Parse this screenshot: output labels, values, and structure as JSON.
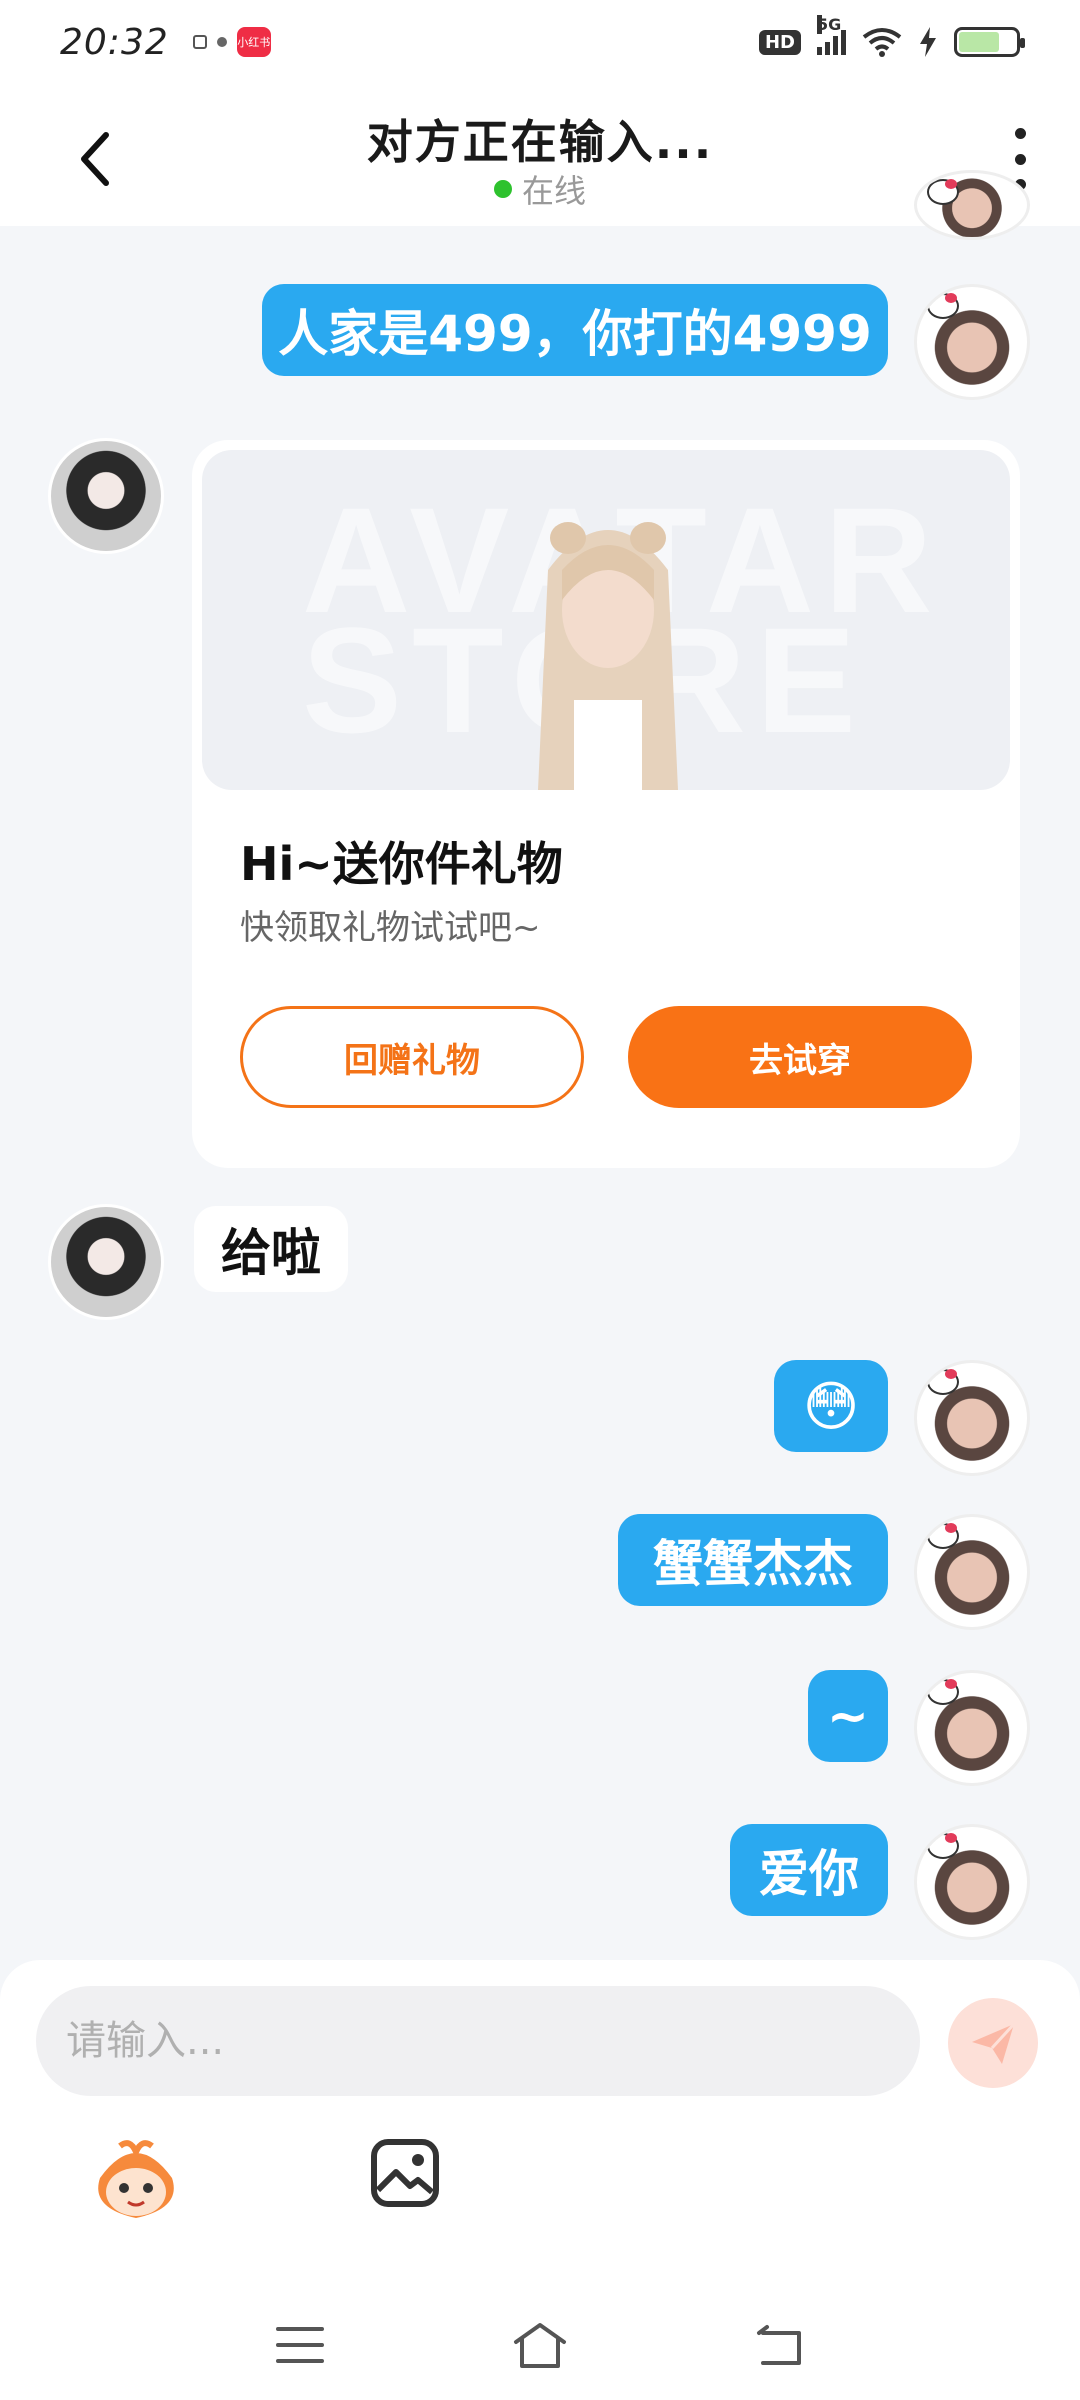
{
  "status_bar": {
    "time": "20:32",
    "app_badge": "小红书",
    "hd": "HD",
    "network": "5G",
    "battery": "72"
  },
  "header": {
    "title": "对方正在输入...",
    "status": "在线"
  },
  "messages": [
    {
      "side": "out",
      "text": "人家是499，你打的4999"
    },
    {
      "side": "in",
      "type": "gift_card"
    },
    {
      "side": "in",
      "text": "给啦"
    },
    {
      "side": "out",
      "text": "😳"
    },
    {
      "side": "out",
      "text": "蟹蟹杰杰"
    },
    {
      "side": "out",
      "text": "~"
    },
    {
      "side": "out",
      "text": "爱你"
    }
  ],
  "gift_card": {
    "watermark": "AVATAR STORE",
    "title": "Hi~送你件礼物",
    "subtitle": "快领取礼物试试吧~",
    "return_gift_label": "回赠礼物",
    "try_on_label": "去试穿"
  },
  "input": {
    "placeholder": "请输入..."
  },
  "colors": {
    "accent_orange": "#f97215",
    "bubble_blue": "#2aa9f0",
    "online_green": "#2ec22e"
  }
}
